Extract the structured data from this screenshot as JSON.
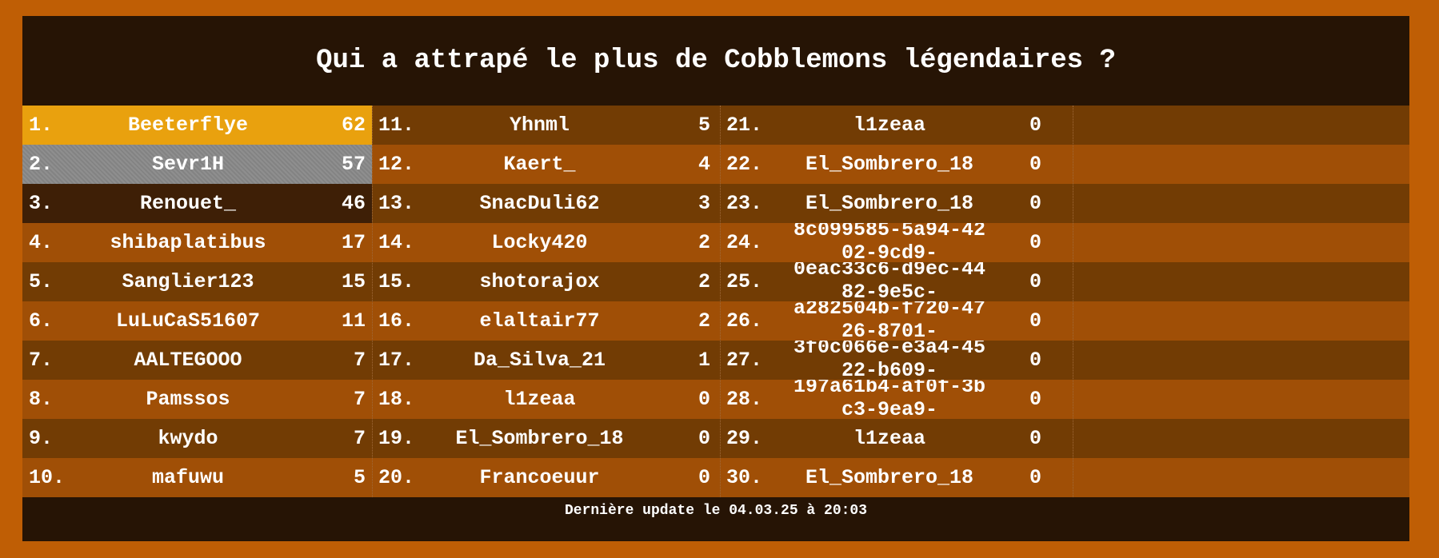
{
  "title": "Qui a attrapé le plus de Cobblemons légendaires ?",
  "footer": "Dernière update le 04.03.25 à 20:03",
  "columns": [
    [
      {
        "rank": "1.",
        "name": "Beeterflye",
        "count": "62",
        "medal": "gold"
      },
      {
        "rank": "2.",
        "name": "Sevr1H",
        "count": "57",
        "medal": "silver"
      },
      {
        "rank": "3.",
        "name": "Renouet_",
        "count": "46",
        "medal": "bronze"
      },
      {
        "rank": "4.",
        "name": "shibaplatibus",
        "count": "17"
      },
      {
        "rank": "5.",
        "name": "Sanglier123",
        "count": "15"
      },
      {
        "rank": "6.",
        "name": "LuLuCaS51607",
        "count": "11"
      },
      {
        "rank": "7.",
        "name": "AALTEGOOO",
        "count": "7"
      },
      {
        "rank": "8.",
        "name": "Pamssos",
        "count": "7"
      },
      {
        "rank": "9.",
        "name": "kwydo",
        "count": "7"
      },
      {
        "rank": "10.",
        "name": "mafuwu",
        "count": "5"
      }
    ],
    [
      {
        "rank": "11.",
        "name": "Yhnml",
        "count": "5"
      },
      {
        "rank": "12.",
        "name": "Kaert_",
        "count": "4"
      },
      {
        "rank": "13.",
        "name": "SnacDuli62",
        "count": "3"
      },
      {
        "rank": "14.",
        "name": "Locky420",
        "count": "2"
      },
      {
        "rank": "15.",
        "name": "shotorajox",
        "count": "2"
      },
      {
        "rank": "16.",
        "name": "elaltair77",
        "count": "2"
      },
      {
        "rank": "17.",
        "name": "Da_Silva_21",
        "count": "1"
      },
      {
        "rank": "18.",
        "name": "l1zeaa",
        "count": "0"
      },
      {
        "rank": "19.",
        "name": "El_Sombrero_18",
        "count": "0"
      },
      {
        "rank": "20.",
        "name": "Francoeuur",
        "count": "0"
      }
    ],
    [
      {
        "rank": "21.",
        "name": "l1zeaa",
        "count": "0"
      },
      {
        "rank": "22.",
        "name": "El_Sombrero_18",
        "count": "0"
      },
      {
        "rank": "23.",
        "name": "El_Sombrero_18",
        "count": "0"
      },
      {
        "rank": "24.",
        "name": "8c099585-5a94-4202-9cd9-",
        "count": "0",
        "wrap": true
      },
      {
        "rank": "25.",
        "name": "0eac33c6-d9ec-4482-9e5c-",
        "count": "0",
        "wrap": true
      },
      {
        "rank": "26.",
        "name": "a282504b-f720-4726-8701-",
        "count": "0",
        "wrap": true
      },
      {
        "rank": "27.",
        "name": "3f0c066e-e3a4-4522-b609-",
        "count": "0",
        "wrap": true
      },
      {
        "rank": "28.",
        "name": "197a61b4-af0f-3bc3-9ea9-",
        "count": "0",
        "wrap": true
      },
      {
        "rank": "29.",
        "name": "l1zeaa",
        "count": "0"
      },
      {
        "rank": "30.",
        "name": "El_Sombrero_18",
        "count": "0"
      }
    ]
  ],
  "colors": {
    "frame": "#BF5E05",
    "panel": "#261405",
    "row_dark": "#723C04",
    "row_light": "#A04F06",
    "gold": "#E9A10E",
    "silver": "#8a8a8a",
    "bronze": "#3E1F06"
  }
}
